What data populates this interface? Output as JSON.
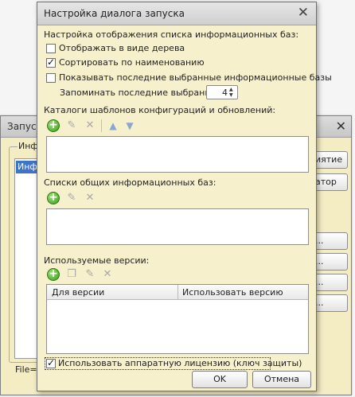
{
  "background_window": {
    "title": "Запуск",
    "group_label": "Инф",
    "list_selected": "Инф",
    "file_label": "File=\"",
    "buttons": [
      "иятие",
      "атор",
      "...",
      "...",
      "...",
      "..."
    ]
  },
  "dialog": {
    "title": "Настройка диалога запуска",
    "section_display": "Настройка отображения списка информационных баз:",
    "opt_tree": {
      "label": "Отображать в виде дерева",
      "checked": false
    },
    "opt_sort": {
      "label": "Сортировать по наименованию",
      "checked": true
    },
    "opt_recent": {
      "label": "Показывать последние выбранные информационные базы",
      "checked": false
    },
    "remember_label": "Запоминать последние выбранные:",
    "remember_value": "4",
    "section_templates": "Каталоги шаблонов конфигураций и обновлений:",
    "section_shared": "Списки общих информационных баз:",
    "section_versions": "Используемые версии:",
    "versions_table": {
      "columns": [
        "Для версии",
        "Использовать версию"
      ],
      "rows": []
    },
    "opt_hw_license": {
      "label": "Использовать аппаратную лицензию (ключ защиты)",
      "checked": true
    },
    "ok_label": "OK",
    "cancel_label": "Отмена"
  },
  "icons": {
    "close": "close-icon",
    "add": "add-icon",
    "edit": "pencil-icon",
    "delete": "delete-icon",
    "up": "arrow-up-icon",
    "down": "arrow-down-icon",
    "copy": "copy-icon"
  }
}
